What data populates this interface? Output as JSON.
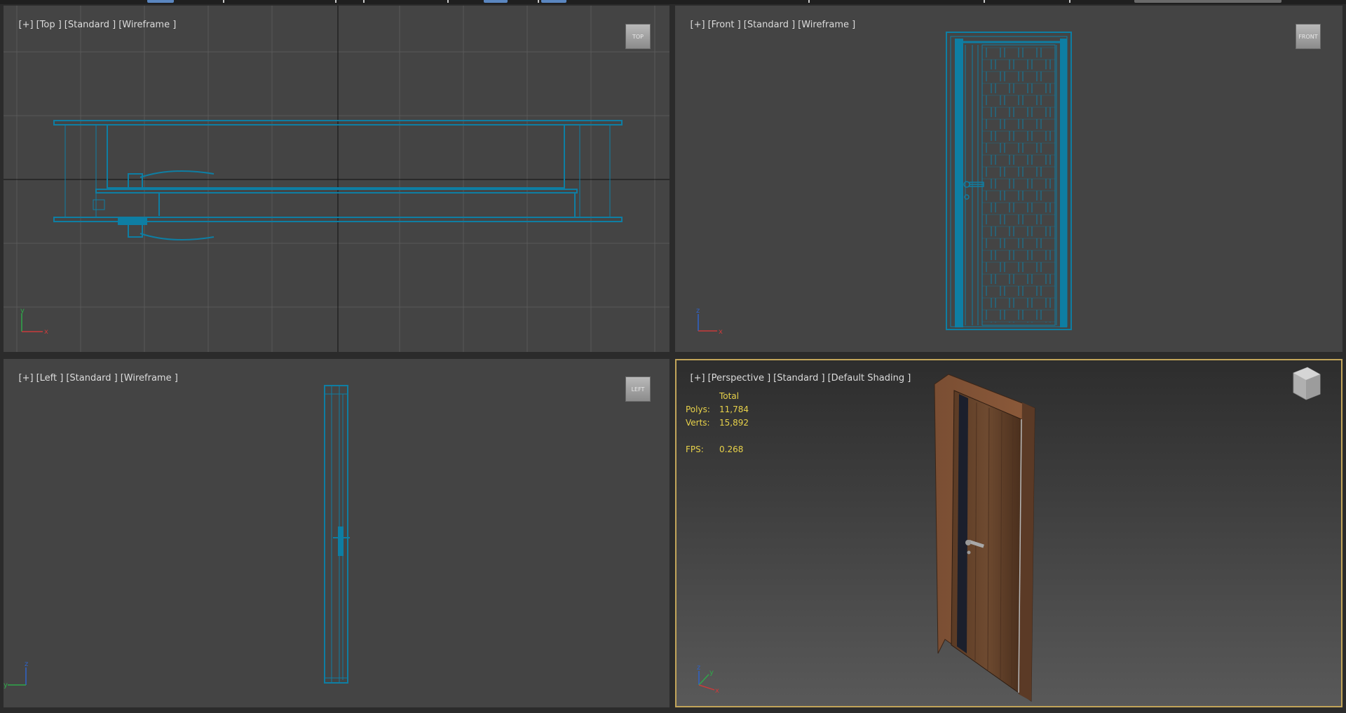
{
  "viewports": {
    "top": {
      "labels": [
        "[+]",
        "[Top ]",
        "[Standard ]",
        "[Wireframe ]"
      ],
      "viewcube": "TOP"
    },
    "front": {
      "labels": [
        "[+]",
        "[Front ]",
        "[Standard ]",
        "[Wireframe ]"
      ],
      "viewcube": "FRONT"
    },
    "left": {
      "labels": [
        "[+]",
        "[Left ]",
        "[Standard ]",
        "[Wireframe ]"
      ],
      "viewcube": "LEFT"
    },
    "perspective": {
      "labels": [
        "[+]",
        "[Perspective ]",
        "[Standard ]",
        "[Default Shading ]"
      ],
      "stats": {
        "header": "Total",
        "polys_label": "Polys:",
        "polys_value": "11,784",
        "verts_label": "Verts:",
        "verts_value": "15,892",
        "fps_label": "FPS:",
        "fps_value": "0.268"
      }
    }
  },
  "axis_labels": {
    "top": [
      "y",
      "x"
    ],
    "front": [
      "z",
      "x"
    ],
    "left": [
      "z",
      "y"
    ],
    "perspective": [
      "z",
      "y",
      "x"
    ]
  },
  "colors": {
    "wireframe": "#0e7ea3",
    "active_border": "#c2a55a",
    "stats_text": "#e8d24a",
    "viewport_bg": "#444444"
  }
}
